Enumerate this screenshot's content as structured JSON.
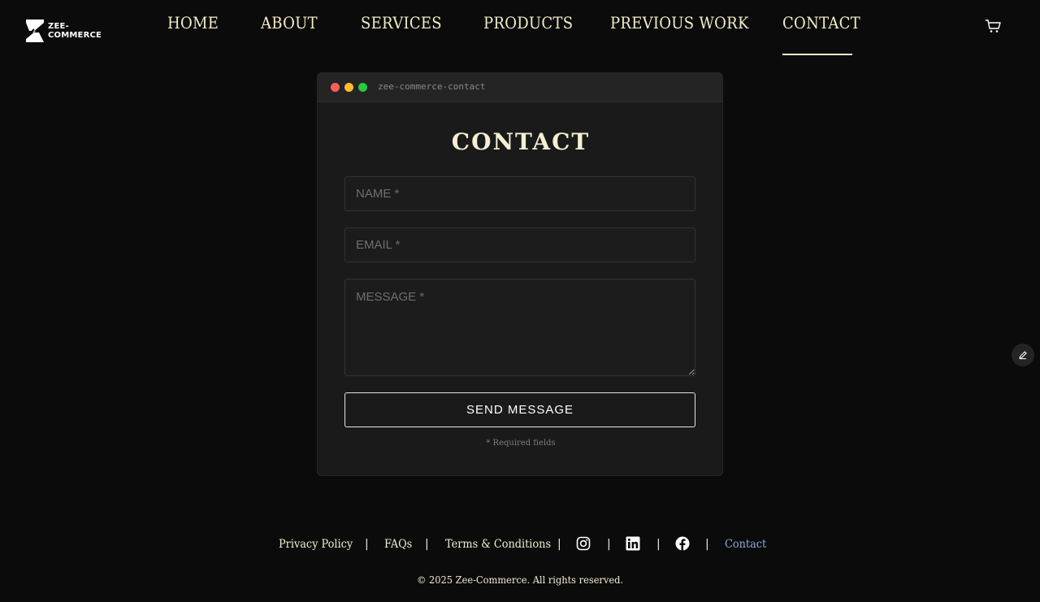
{
  "brand": {
    "line1": "ZEE-",
    "line2": "COMMERCE"
  },
  "nav": {
    "items": [
      {
        "label": "HOME"
      },
      {
        "label": "ABOUT"
      },
      {
        "label": "SERVICES"
      },
      {
        "label": "PRODUCTS"
      },
      {
        "label": "PREVIOUS WORK"
      },
      {
        "label": "CONTACT"
      }
    ],
    "active": "CONTACT"
  },
  "card": {
    "window_title": "zee-commerce-contact",
    "heading": "CONTACT",
    "fields": {
      "name_placeholder": "NAME *",
      "email_placeholder": "EMAIL *",
      "message_placeholder": "MESSAGE *"
    },
    "submit_label": "SEND MESSAGE",
    "required_note": "* Required fields"
  },
  "footer": {
    "privacy": "Privacy Policy",
    "faqs": "FAQs",
    "terms": "Terms & Conditions",
    "contact": "Contact",
    "separator": "|",
    "copyright": "© 2025 Zee-Commerce. All rights reserved."
  },
  "colors": {
    "background": "#0b0b0b",
    "card": "#1a1a1a",
    "text_cream": "#f3ecd0",
    "link_blue": "#8fa6d9"
  },
  "icons": [
    "cart-icon",
    "instagram-icon",
    "linkedin-icon",
    "facebook-icon",
    "pencil-icon"
  ]
}
